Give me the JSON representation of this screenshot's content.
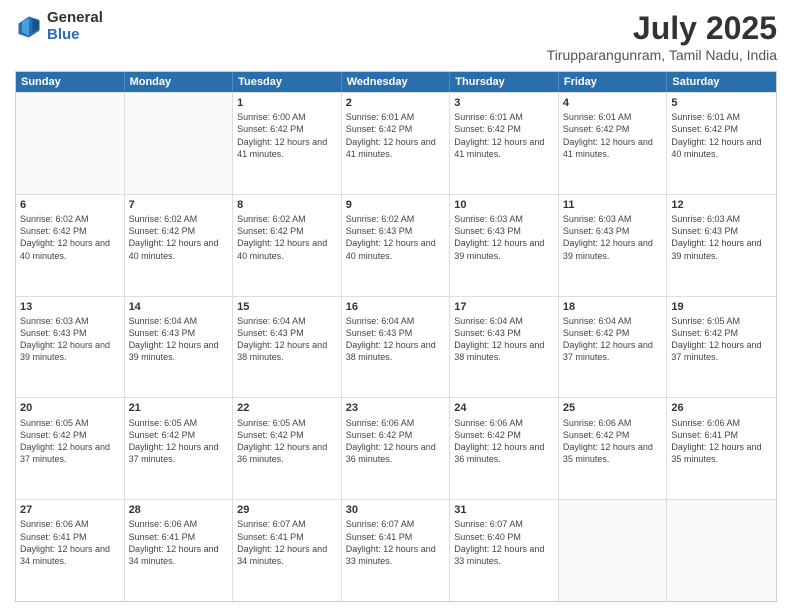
{
  "logo": {
    "general": "General",
    "blue": "Blue"
  },
  "title": "July 2025",
  "subtitle": "Tirupparangunram, Tamil Nadu, India",
  "header_days": [
    "Sunday",
    "Monday",
    "Tuesday",
    "Wednesday",
    "Thursday",
    "Friday",
    "Saturday"
  ],
  "rows": [
    [
      {
        "day": "",
        "info": "",
        "empty": true
      },
      {
        "day": "",
        "info": "",
        "empty": true
      },
      {
        "day": "1",
        "info": "Sunrise: 6:00 AM\nSunset: 6:42 PM\nDaylight: 12 hours and 41 minutes."
      },
      {
        "day": "2",
        "info": "Sunrise: 6:01 AM\nSunset: 6:42 PM\nDaylight: 12 hours and 41 minutes."
      },
      {
        "day": "3",
        "info": "Sunrise: 6:01 AM\nSunset: 6:42 PM\nDaylight: 12 hours and 41 minutes."
      },
      {
        "day": "4",
        "info": "Sunrise: 6:01 AM\nSunset: 6:42 PM\nDaylight: 12 hours and 41 minutes."
      },
      {
        "day": "5",
        "info": "Sunrise: 6:01 AM\nSunset: 6:42 PM\nDaylight: 12 hours and 40 minutes."
      }
    ],
    [
      {
        "day": "6",
        "info": "Sunrise: 6:02 AM\nSunset: 6:42 PM\nDaylight: 12 hours and 40 minutes."
      },
      {
        "day": "7",
        "info": "Sunrise: 6:02 AM\nSunset: 6:42 PM\nDaylight: 12 hours and 40 minutes."
      },
      {
        "day": "8",
        "info": "Sunrise: 6:02 AM\nSunset: 6:42 PM\nDaylight: 12 hours and 40 minutes."
      },
      {
        "day": "9",
        "info": "Sunrise: 6:02 AM\nSunset: 6:43 PM\nDaylight: 12 hours and 40 minutes."
      },
      {
        "day": "10",
        "info": "Sunrise: 6:03 AM\nSunset: 6:43 PM\nDaylight: 12 hours and 39 minutes."
      },
      {
        "day": "11",
        "info": "Sunrise: 6:03 AM\nSunset: 6:43 PM\nDaylight: 12 hours and 39 minutes."
      },
      {
        "day": "12",
        "info": "Sunrise: 6:03 AM\nSunset: 6:43 PM\nDaylight: 12 hours and 39 minutes."
      }
    ],
    [
      {
        "day": "13",
        "info": "Sunrise: 6:03 AM\nSunset: 6:43 PM\nDaylight: 12 hours and 39 minutes."
      },
      {
        "day": "14",
        "info": "Sunrise: 6:04 AM\nSunset: 6:43 PM\nDaylight: 12 hours and 39 minutes."
      },
      {
        "day": "15",
        "info": "Sunrise: 6:04 AM\nSunset: 6:43 PM\nDaylight: 12 hours and 38 minutes."
      },
      {
        "day": "16",
        "info": "Sunrise: 6:04 AM\nSunset: 6:43 PM\nDaylight: 12 hours and 38 minutes."
      },
      {
        "day": "17",
        "info": "Sunrise: 6:04 AM\nSunset: 6:43 PM\nDaylight: 12 hours and 38 minutes."
      },
      {
        "day": "18",
        "info": "Sunrise: 6:04 AM\nSunset: 6:42 PM\nDaylight: 12 hours and 37 minutes."
      },
      {
        "day": "19",
        "info": "Sunrise: 6:05 AM\nSunset: 6:42 PM\nDaylight: 12 hours and 37 minutes."
      }
    ],
    [
      {
        "day": "20",
        "info": "Sunrise: 6:05 AM\nSunset: 6:42 PM\nDaylight: 12 hours and 37 minutes."
      },
      {
        "day": "21",
        "info": "Sunrise: 6:05 AM\nSunset: 6:42 PM\nDaylight: 12 hours and 37 minutes."
      },
      {
        "day": "22",
        "info": "Sunrise: 6:05 AM\nSunset: 6:42 PM\nDaylight: 12 hours and 36 minutes."
      },
      {
        "day": "23",
        "info": "Sunrise: 6:06 AM\nSunset: 6:42 PM\nDaylight: 12 hours and 36 minutes."
      },
      {
        "day": "24",
        "info": "Sunrise: 6:06 AM\nSunset: 6:42 PM\nDaylight: 12 hours and 36 minutes."
      },
      {
        "day": "25",
        "info": "Sunrise: 6:06 AM\nSunset: 6:42 PM\nDaylight: 12 hours and 35 minutes."
      },
      {
        "day": "26",
        "info": "Sunrise: 6:06 AM\nSunset: 6:41 PM\nDaylight: 12 hours and 35 minutes."
      }
    ],
    [
      {
        "day": "27",
        "info": "Sunrise: 6:06 AM\nSunset: 6:41 PM\nDaylight: 12 hours and 34 minutes."
      },
      {
        "day": "28",
        "info": "Sunrise: 6:06 AM\nSunset: 6:41 PM\nDaylight: 12 hours and 34 minutes."
      },
      {
        "day": "29",
        "info": "Sunrise: 6:07 AM\nSunset: 6:41 PM\nDaylight: 12 hours and 34 minutes."
      },
      {
        "day": "30",
        "info": "Sunrise: 6:07 AM\nSunset: 6:41 PM\nDaylight: 12 hours and 33 minutes."
      },
      {
        "day": "31",
        "info": "Sunrise: 6:07 AM\nSunset: 6:40 PM\nDaylight: 12 hours and 33 minutes."
      },
      {
        "day": "",
        "info": "",
        "empty": true
      },
      {
        "day": "",
        "info": "",
        "empty": true
      }
    ]
  ]
}
